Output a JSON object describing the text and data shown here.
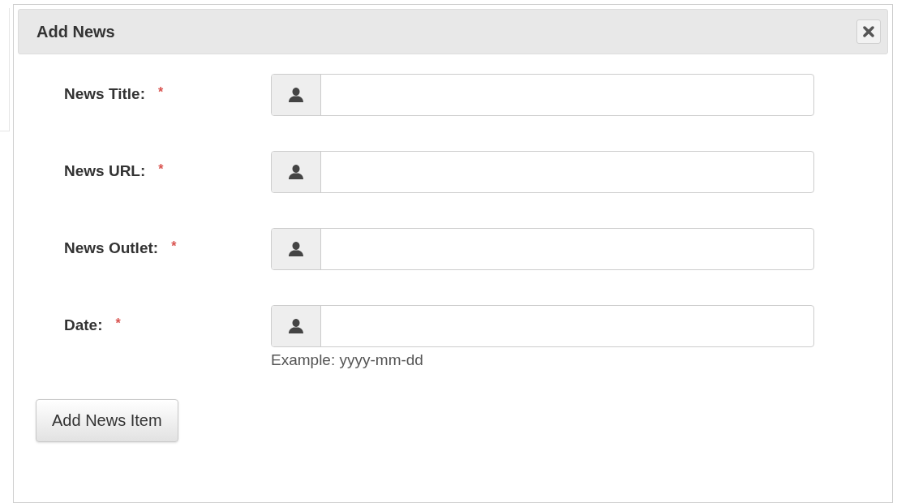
{
  "dialog": {
    "title": "Add News",
    "fields": [
      {
        "label": "News Title:",
        "required_mark": "*"
      },
      {
        "label": "News URL:",
        "required_mark": "*"
      },
      {
        "label": "News Outlet:",
        "required_mark": "*"
      },
      {
        "label": "Date:",
        "required_mark": "*",
        "help": "Example: yyyy-mm-dd"
      }
    ],
    "submit": "Add News Item"
  }
}
